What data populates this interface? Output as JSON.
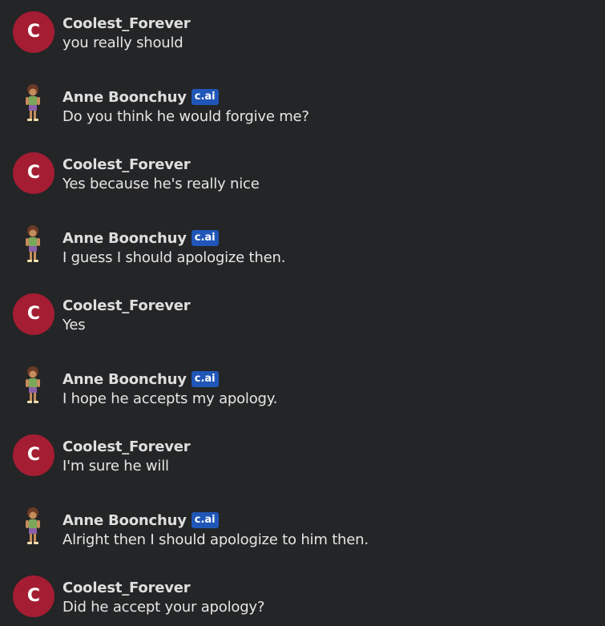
{
  "badge_label": "c.ai",
  "user_initial": "C",
  "colors": {
    "background": "#242526",
    "user_avatar": "#a41d33",
    "badge": "#1f56b8",
    "text": "#e6e6e6"
  },
  "messages": [
    {
      "author": "Coolest_Forever",
      "text": "you really should"
    },
    {
      "author": "Anne Boonchuy",
      "text": "Do you think he would forgive me?"
    },
    {
      "author": "Coolest_Forever",
      "text": "Yes because he's really nice"
    },
    {
      "author": "Anne Boonchuy",
      "text": "I guess I should apologize then."
    },
    {
      "author": "Coolest_Forever",
      "text": "Yes"
    },
    {
      "author": "Anne Boonchuy",
      "text": "I hope he accepts my apology."
    },
    {
      "author": "Coolest_Forever",
      "text": "I'm sure he will"
    },
    {
      "author": "Anne Boonchuy",
      "text": "Alright then I should apologize to him then."
    },
    {
      "author": "Coolest_Forever",
      "text": "Did he accept your apology?"
    }
  ]
}
